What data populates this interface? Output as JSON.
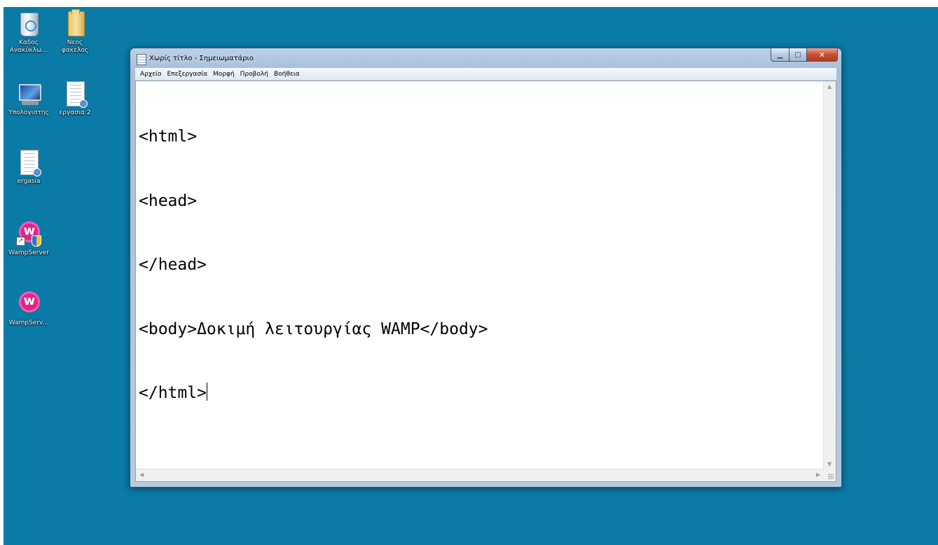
{
  "desktop": {
    "background_color": "#0a7aa6",
    "icons": [
      {
        "label": "Καδος\nΑνακύκλω...",
        "icon": "recycle-bin-icon"
      },
      {
        "label": "Νεος\nφακελος",
        "icon": "folder-icon"
      },
      {
        "label": "Υπολογιστης",
        "icon": "computer-icon"
      },
      {
        "label": "εργασια 2",
        "icon": "document-icon"
      },
      {
        "label": "ergasia",
        "icon": "document-icon"
      },
      {
        "label": "WampServer",
        "icon": "wampserver-icon"
      },
      {
        "label": "WampServ...",
        "icon": "wampserver-icon"
      }
    ]
  },
  "window": {
    "title": "Χωρίς τίτλο - Σημειωματάριο",
    "buttons": {
      "minimize": "minimize-icon",
      "maximize": "maximize-icon",
      "close": "close-icon"
    },
    "menu": [
      "Αρχείο",
      "Επεξεργασία",
      "Μορφή",
      "Προβολή",
      "Βοήθεια"
    ],
    "editor_lines": [
      "<html>",
      "<head>",
      "</head>",
      "<body>Δοκιμή λειτουργίας WAMP</body>",
      "</html>"
    ]
  }
}
